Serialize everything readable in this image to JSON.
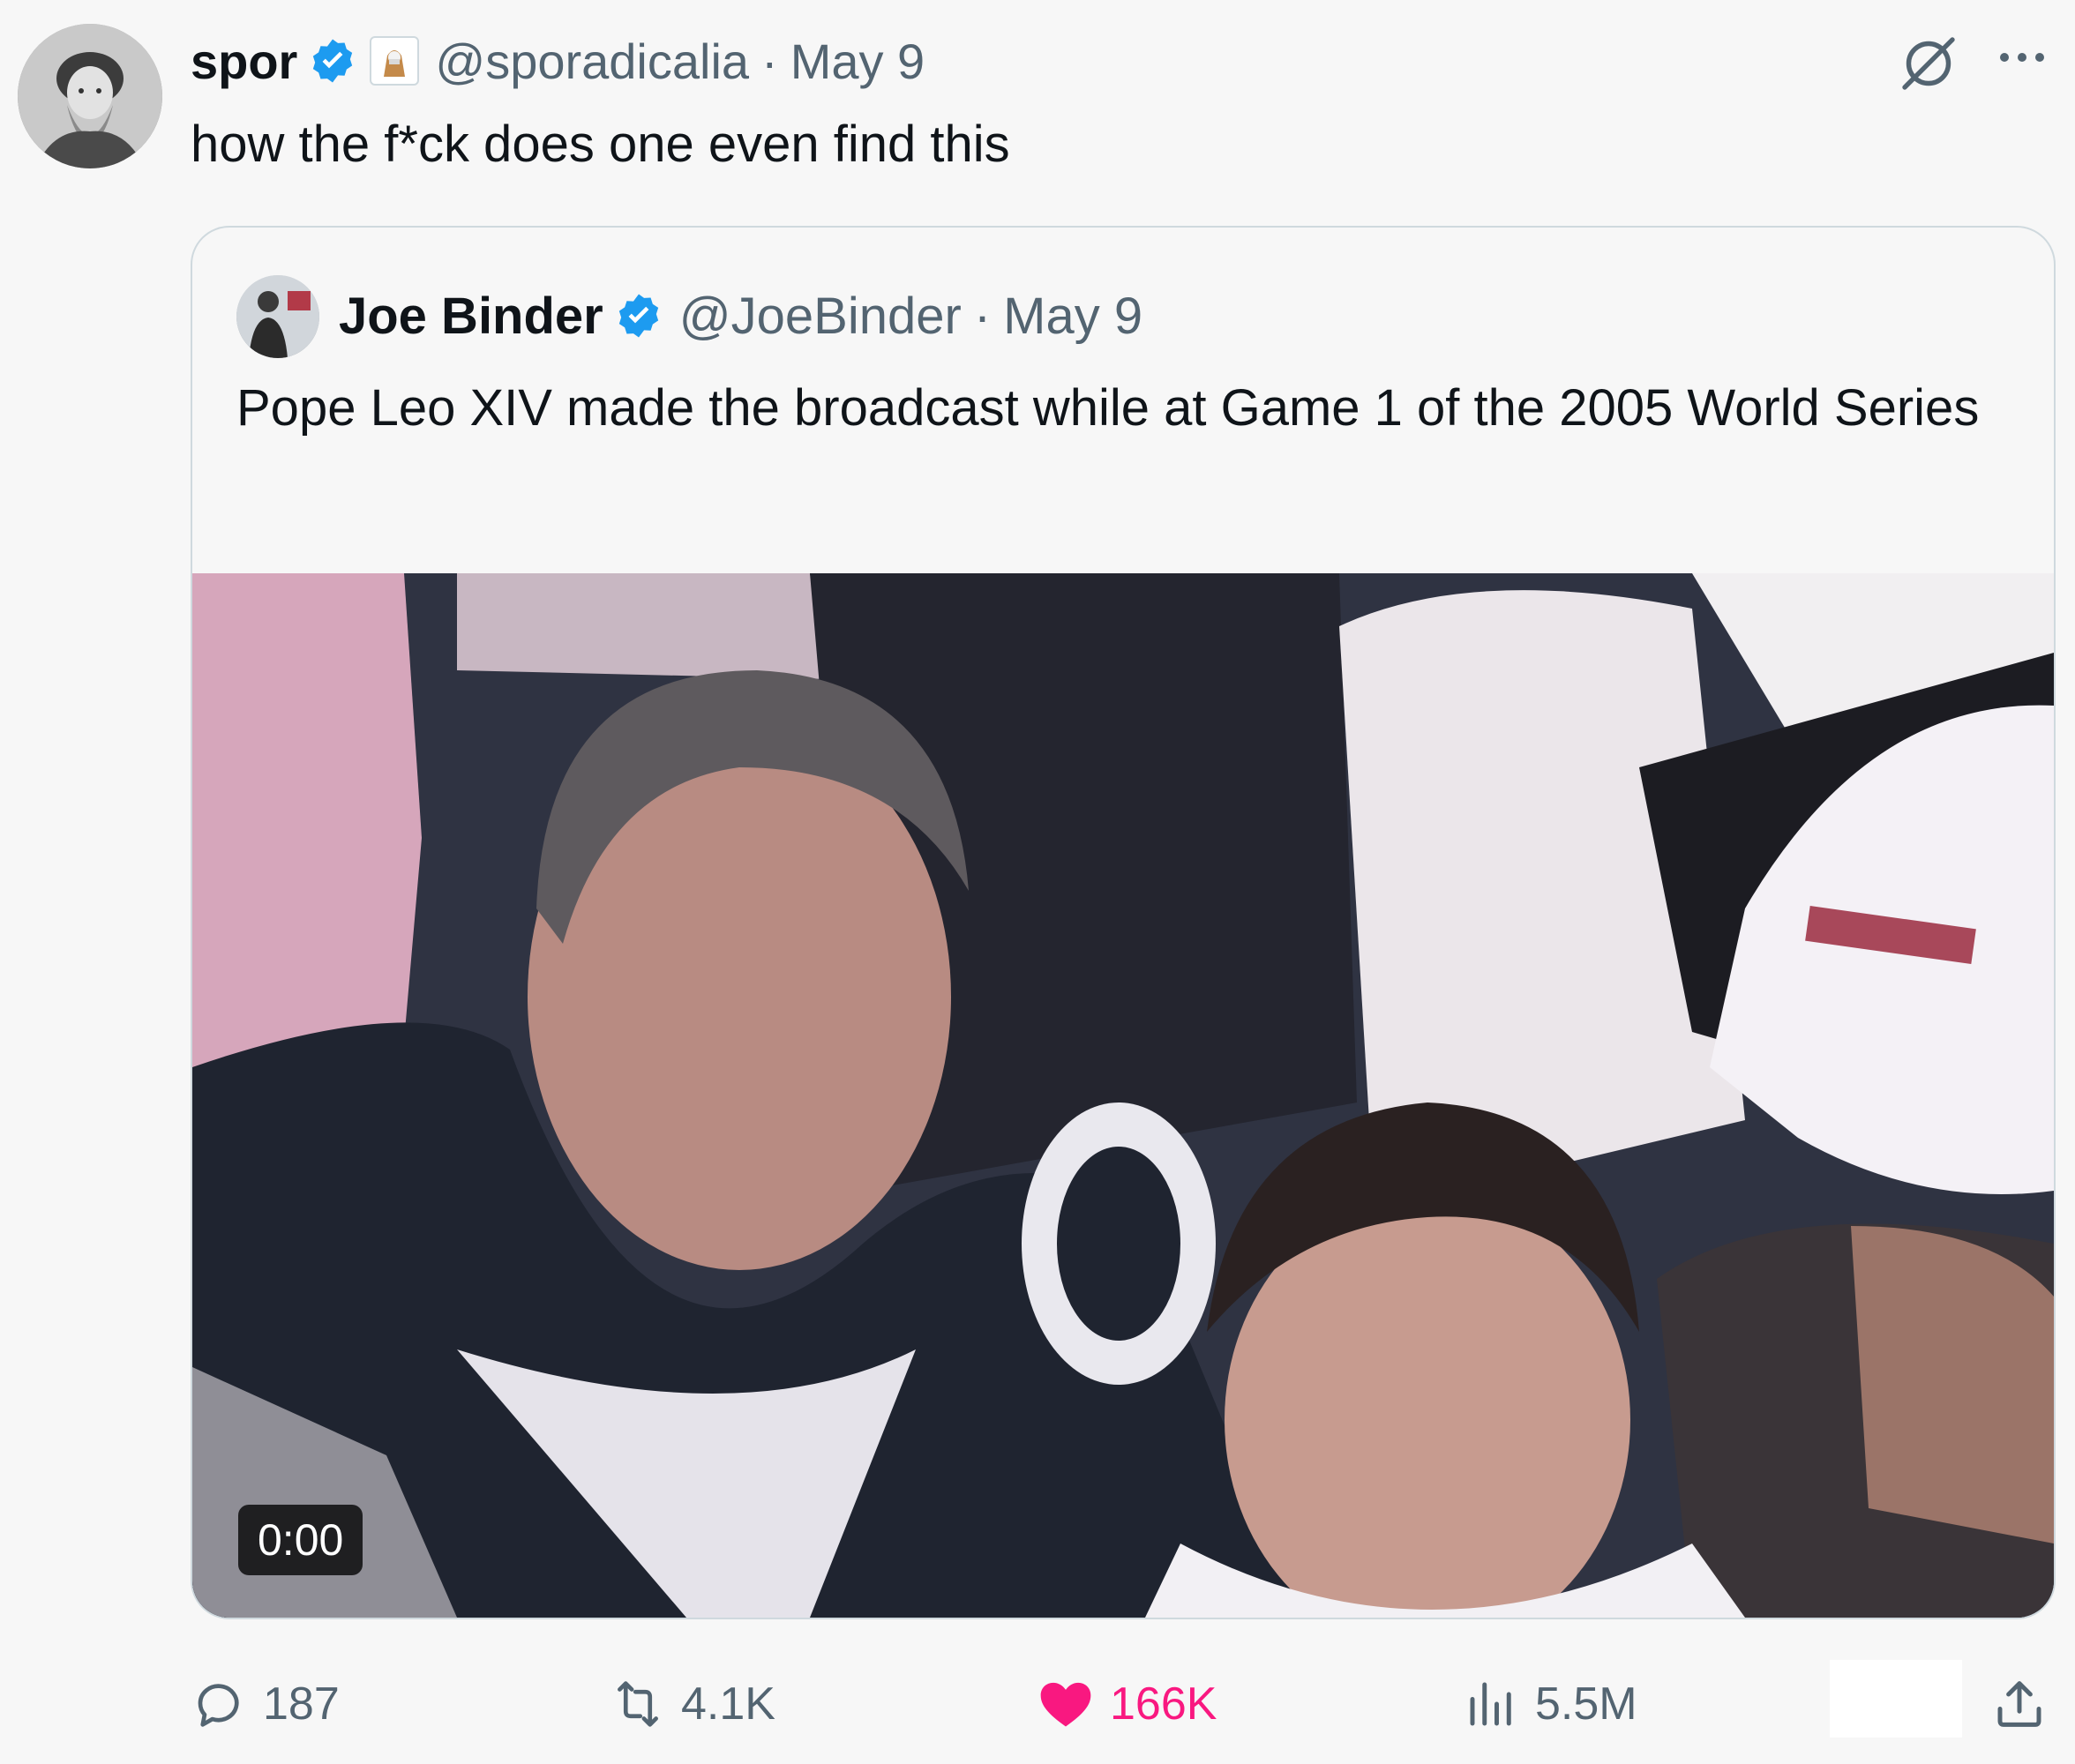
{
  "tweet": {
    "author_name": "spor",
    "handle": "@sporadicalia",
    "separator": "·",
    "date": "May 9",
    "text": "how the f*ck does one even find this"
  },
  "quoted_tweet": {
    "author_name": "Joe Binder",
    "handle": "@JoeBinder",
    "separator": "·",
    "date": "May 9",
    "text": "Pope Leo XIV made the broadcast while at Game 1 of the 2005 World Series",
    "video": {
      "timestamp": "0:00"
    }
  },
  "actions": {
    "replies": "187",
    "reposts": "4.1K",
    "likes": "166K",
    "views": "5.5M"
  },
  "icons": {
    "verified": "verified-badge-icon",
    "grok": "grok-icon",
    "more": "more-icon",
    "reply": "reply-icon",
    "repost": "repost-icon",
    "like": "heart-icon",
    "views": "views-icon",
    "share": "share-icon"
  },
  "colors": {
    "verified_blue": "#1d9bf0",
    "like_pink": "#f91880",
    "secondary_text": "#536471",
    "primary_text": "#0f1419"
  }
}
